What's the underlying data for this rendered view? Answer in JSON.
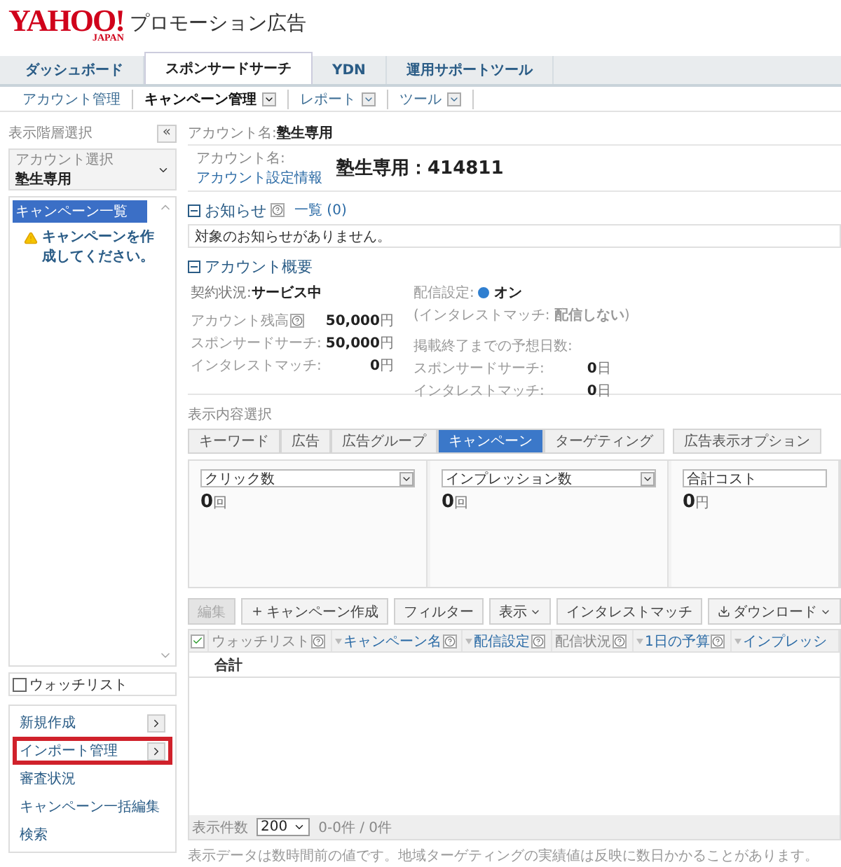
{
  "header": {
    "logo": "YAHOO!",
    "logo_sub": "JAPAN",
    "title": "プロモーション広告"
  },
  "tabs": [
    {
      "label": "ダッシュボード",
      "selected": false
    },
    {
      "label": "スポンサードサーチ",
      "selected": true
    },
    {
      "label": "YDN",
      "selected": false
    },
    {
      "label": "運用サポートツール",
      "selected": false
    }
  ],
  "subnav": [
    {
      "label": "アカウント管理",
      "selected": false,
      "menu": false
    },
    {
      "label": "キャンペーン管理",
      "selected": true,
      "menu": true
    },
    {
      "label": "レポート",
      "selected": false,
      "menu": true
    },
    {
      "label": "ツール",
      "selected": false,
      "menu": true
    }
  ],
  "sidebar": {
    "title": "表示階層選択",
    "collapse": "«",
    "account_select": {
      "label": "アカウント選択",
      "value": "塾生専用"
    },
    "tree": [
      {
        "label": "キャンペーン一覧",
        "selected": true
      }
    ],
    "warning": "キャンペーンを作成してください。",
    "watchlist": {
      "label": "ウォッチリスト",
      "checked": false
    },
    "menu": [
      {
        "label": "新規作成",
        "submenu": true,
        "highlighted": false
      },
      {
        "label": "インポート管理",
        "submenu": true,
        "highlighted": true
      },
      {
        "label": "審査状況",
        "submenu": false,
        "highlighted": false
      },
      {
        "label": "キャンペーン一括編集",
        "submenu": false,
        "highlighted": false
      },
      {
        "label": "検索",
        "submenu": false,
        "highlighted": false
      }
    ]
  },
  "breadcrumb": {
    "label": "アカウント名:",
    "value": "塾生専用"
  },
  "account": {
    "label": "アカウント名:",
    "link": "アカウント設定情報",
    "name": "塾生専用：414811"
  },
  "notice": {
    "title": "お知らせ",
    "help": true,
    "link": "一覧 (0)",
    "message": "対象のお知らせがありません。",
    "expanded": true
  },
  "overview": {
    "title": "アカウント概要",
    "expanded": true,
    "status": {
      "label": "契約状況:",
      "value": "サービス中"
    },
    "balances": [
      {
        "label": "アカウント残高",
        "help": true,
        "value": "50,000",
        "unit": "円"
      },
      {
        "label": "スポンサードサーチ:",
        "help": false,
        "value": "50,000",
        "unit": "円"
      },
      {
        "label": "インタレストマッチ:",
        "help": false,
        "value": "0",
        "unit": "円"
      }
    ],
    "delivery": [
      {
        "kind": "radio",
        "label": "配信設定:",
        "value": "オン",
        "checked": true
      },
      {
        "kind": "note",
        "text": "(インタレストマッチ: **配信しない**)"
      },
      {
        "kind": "heading",
        "text": "掲載終了までの予想日数:"
      },
      {
        "kind": "pair",
        "label": "スポンサードサーチ:",
        "value": "0",
        "unit": "日"
      },
      {
        "kind": "pair",
        "label": "インタレストマッチ:",
        "value": "0",
        "unit": "日"
      }
    ]
  },
  "view_select": {
    "title": "表示内容選択",
    "tabs": [
      {
        "label": "キーワード",
        "selected": false
      },
      {
        "label": "広告",
        "selected": false
      },
      {
        "label": "広告グループ",
        "selected": false
      },
      {
        "label": "キャンペーン",
        "selected": true
      },
      {
        "label": "ターゲティング",
        "selected": false
      }
    ],
    "option_button": "広告表示オプション"
  },
  "metrics": [
    {
      "metric": "クリック数",
      "caret": true,
      "value": "0",
      "unit": "回"
    },
    {
      "metric": "インプレッション数",
      "caret": true,
      "value": "0",
      "unit": "回"
    },
    {
      "metric": "合計コスト",
      "caret": false,
      "value": "0",
      "unit": "円"
    }
  ],
  "toolbar": [
    {
      "label": "編集",
      "disabled": true,
      "kind": "plain"
    },
    {
      "label": "キャンペーン作成",
      "disabled": false,
      "kind": "add"
    },
    {
      "label": "フィルター",
      "disabled": false,
      "kind": "plain"
    },
    {
      "label": "表示",
      "disabled": false,
      "kind": "dropdown"
    },
    {
      "label": "インタレストマッチ",
      "disabled": false,
      "kind": "plain"
    },
    {
      "label": "ダウンロード",
      "disabled": false,
      "kind": "download"
    }
  ],
  "table": {
    "select_all": {
      "checked": true
    },
    "columns": [
      {
        "label": "ウォッチリスト",
        "sortable": false,
        "help": true
      },
      {
        "label": "キャンペーン名",
        "sortable": true,
        "help": true
      },
      {
        "label": "配信設定",
        "sortable": true,
        "help": true
      },
      {
        "label": "配信状況",
        "sortable": false,
        "help": true
      },
      {
        "label": "1日の予算",
        "sortable": true,
        "help": true
      },
      {
        "label": "インプレッシ",
        "sortable": true,
        "help": false
      }
    ],
    "total_label": "合計"
  },
  "pager": {
    "label": "表示件数",
    "page_size": "200",
    "range": "0-0件 / 0件"
  },
  "footnote": "表示データは数時間前の値です。地域ターゲティングの実績値は反映に数日かかることがあります。"
}
